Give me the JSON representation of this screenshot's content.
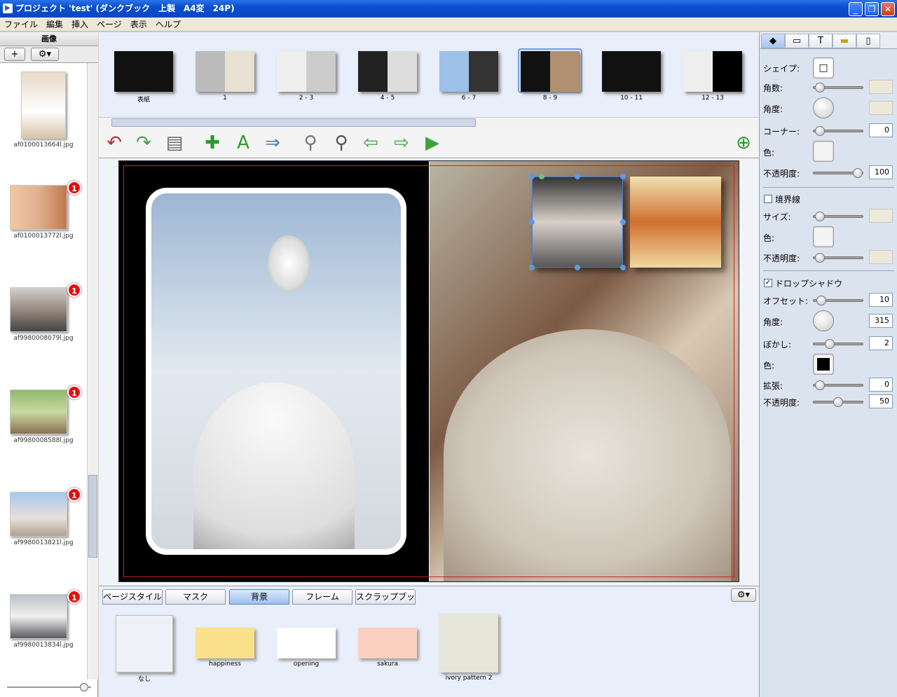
{
  "window": {
    "title": "プロジェクト 'test' (ダンクブック　上製　A4変　24P)"
  },
  "menu": [
    "ファイル",
    "編集",
    "挿入",
    "ページ",
    "表示",
    "ヘルプ"
  ],
  "left_panel": {
    "title": "画像",
    "add_label": "+",
    "images": [
      {
        "name": "af0100013664l.jpg",
        "badge": ""
      },
      {
        "name": "af0100013772l.jpg",
        "badge": "1"
      },
      {
        "name": "af9980008079l.jpg",
        "badge": "1"
      },
      {
        "name": "af9980008588l.jpg",
        "badge": "1"
      },
      {
        "name": "af9980013821l.jpg",
        "badge": "1"
      },
      {
        "name": "af9980013834l.jpg",
        "badge": "1"
      }
    ]
  },
  "pages": [
    {
      "label": "表紙"
    },
    {
      "label": "1"
    },
    {
      "label": "2 - 3"
    },
    {
      "label": "4 - 5"
    },
    {
      "label": "6 - 7"
    },
    {
      "label": "8 - 9",
      "selected": true
    },
    {
      "label": "10 - 11"
    },
    {
      "label": "12 - 13"
    }
  ],
  "tabs": [
    {
      "label": "ページスタイル"
    },
    {
      "label": "マスク"
    },
    {
      "label": "背景",
      "active": true
    },
    {
      "label": "フレーム"
    },
    {
      "label": "スクラップブック"
    }
  ],
  "backgrounds": [
    {
      "name": "なし"
    },
    {
      "name": "happiness"
    },
    {
      "name": "opening"
    },
    {
      "name": "sakura"
    },
    {
      "name": "ivory pattern 2"
    }
  ],
  "properties": {
    "shape": "シェイプ:",
    "corners": {
      "label": "角数:",
      "value": ""
    },
    "angle": {
      "label": "角度:",
      "value": ""
    },
    "corner": {
      "label": "コーナー:",
      "value": "0"
    },
    "color": {
      "label": "色:"
    },
    "opacity": {
      "label": "不透明度:",
      "value": "100"
    },
    "border": {
      "label": "境界線",
      "checked": false
    },
    "border_size": {
      "label": "サイズ:",
      "value": ""
    },
    "border_color": {
      "label": "色:"
    },
    "border_opacity": {
      "label": "不透明度:",
      "value": ""
    },
    "shadow": {
      "label": "ドロップシャドウ",
      "checked": true
    },
    "shadow_offset": {
      "label": "オフセット:",
      "value": "10"
    },
    "shadow_angle": {
      "label": "角度:",
      "value": "315"
    },
    "shadow_blur": {
      "label": "ぼかし:",
      "value": "2"
    },
    "shadow_color": {
      "label": "色:",
      "color": "#000000"
    },
    "shadow_spread": {
      "label": "拡張:",
      "value": "0"
    },
    "shadow_opacity": {
      "label": "不透明度:",
      "value": "50"
    }
  }
}
